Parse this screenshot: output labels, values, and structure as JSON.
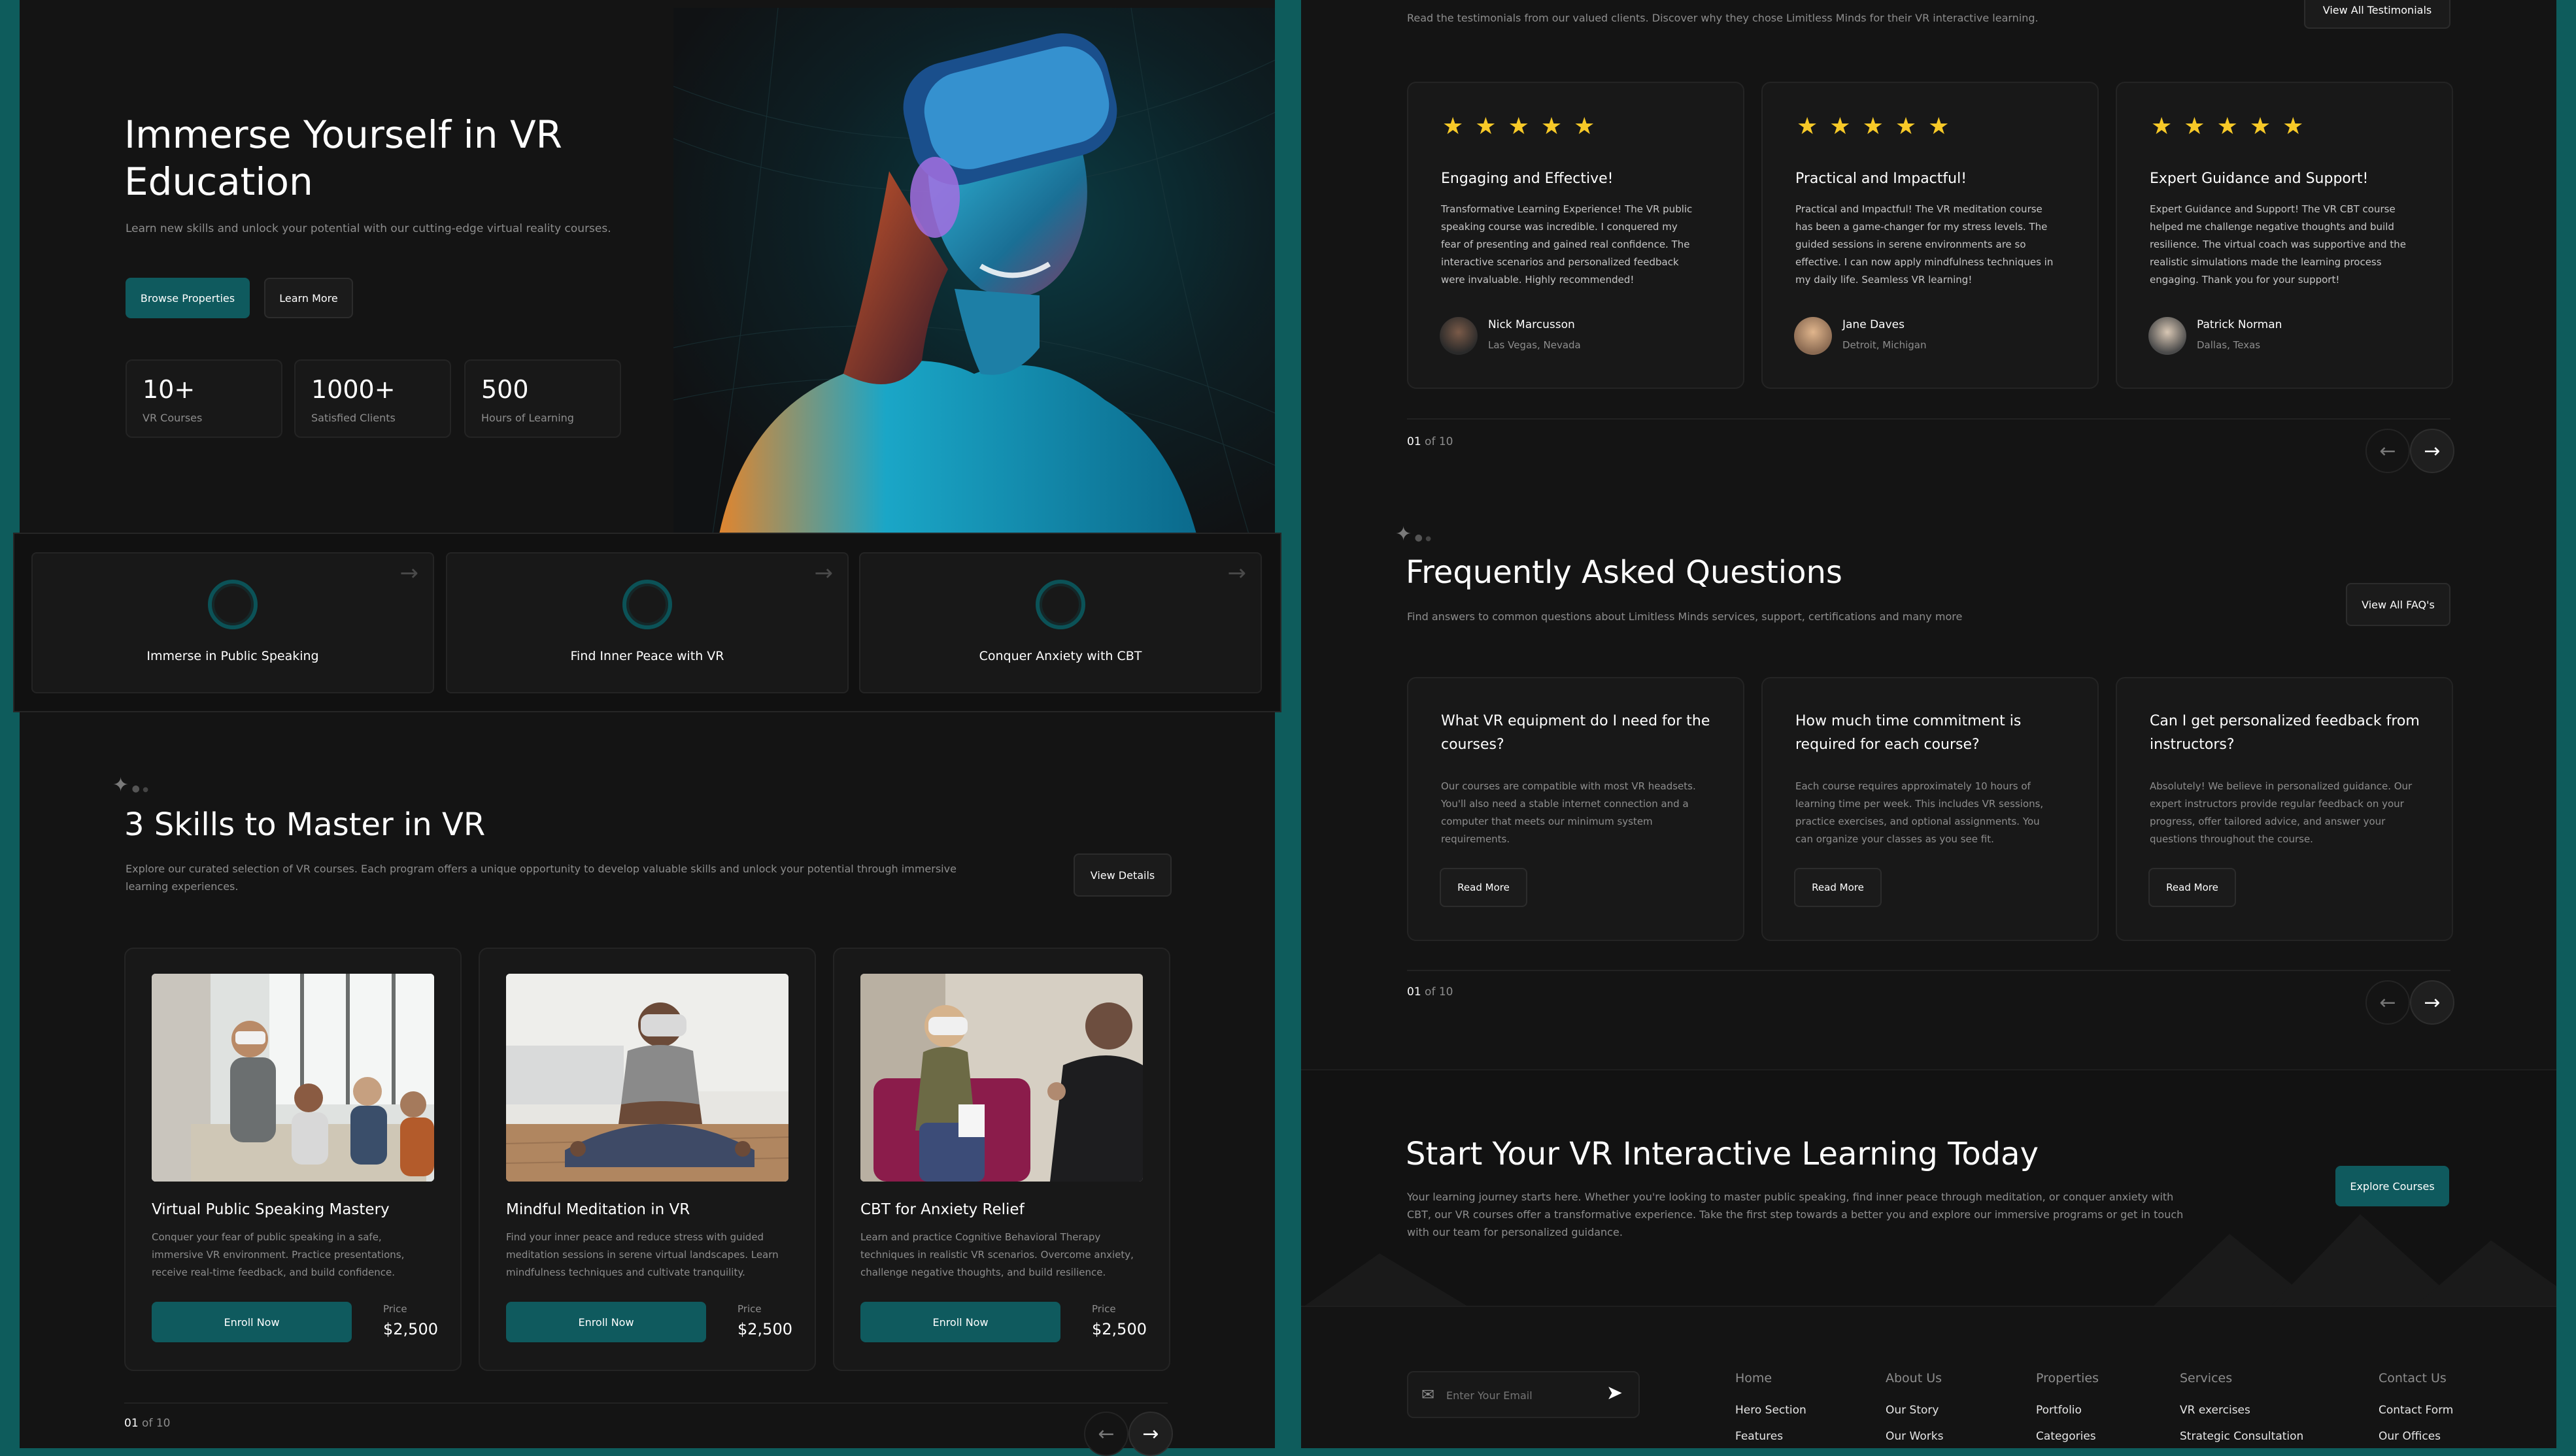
{
  "colors": {
    "background": "#0e5c5c",
    "panel": "#141414",
    "accent": "#0f5a5e",
    "star": "#f7c928"
  },
  "hero": {
    "title_line1": "Immerse Yourself in VR",
    "title_line2": "Education",
    "subtitle": "Learn new skills and unlock your potential with our cutting-edge virtual reality courses.",
    "primary_button": "Browse Properties",
    "secondary_button": "Learn More",
    "stats": [
      {
        "value": "10+",
        "label": "VR Courses"
      },
      {
        "value": "1000+",
        "label": "Satisfied Clients"
      },
      {
        "value": "500",
        "label": "Hours of Learning"
      }
    ]
  },
  "features": [
    {
      "label": "Immerse in Public Speaking",
      "icon": "arrow-up-right-icon"
    },
    {
      "label": "Find Inner Peace with VR",
      "icon": "arrow-up-right-icon"
    },
    {
      "label": "Conquer Anxiety with CBT",
      "icon": "arrow-up-right-icon"
    }
  ],
  "skills": {
    "title": "3 Skills to Master in VR",
    "description_line1": "Explore our curated selection of VR courses. Each program offers a unique opportunity to develop valuable skills and unlock your potential through immersive",
    "description_line2": "learning experiences.",
    "view_button": "View Details",
    "courses": [
      {
        "title": "Virtual Public Speaking Mastery",
        "desc1": "Conquer your fear of public speaking in a safe,",
        "desc2": "immersive VR environment. Practice presentations,",
        "desc3": "receive real-time feedback, and build confidence.",
        "enroll": "Enroll Now",
        "price_label": "Price",
        "price": "$2,500"
      },
      {
        "title": "Mindful Meditation in VR",
        "desc1": "Find your inner peace and reduce stress with guided",
        "desc2": "meditation sessions in serene virtual landscapes. Learn",
        "desc3": "mindfulness techniques and cultivate tranquility.",
        "enroll": "Enroll Now",
        "price_label": "Price",
        "price": "$2,500"
      },
      {
        "title": "CBT for Anxiety Relief",
        "desc1": "Learn and practice Cognitive Behavioral Therapy",
        "desc2": "techniques in realistic VR scenarios. Overcome anxiety,",
        "desc3": "challenge negative thoughts, and build resilience.",
        "enroll": "Enroll Now",
        "price_label": "Price",
        "price": "$2,500"
      }
    ],
    "pager_current": "01",
    "pager_of": " of 10"
  },
  "testimonials": {
    "intro": "Read the testimonials from our valued clients. Discover why they chose Limitless Minds for their VR interactive learning.",
    "view_all": "View All Testimonials",
    "items": [
      {
        "title": "Engaging and Effective!",
        "l1": "Transformative Learning Experience! The VR public",
        "l2": "speaking course was incredible. I conquered my",
        "l3": "fear of presenting and gained real confidence. The",
        "l4": "interactive scenarios and personalized feedback",
        "l5": "were invaluable. Highly recommended!",
        "name": "Nick Marcusson",
        "location": "Las Vegas, Nevada"
      },
      {
        "title": "Practical and Impactful!",
        "l1": "Practical and Impactful! The VR meditation course",
        "l2": "has been a game-changer for my stress levels. The",
        "l3": "guided sessions in serene environments are so",
        "l4": "effective. I can now apply mindfulness techniques in",
        "l5": "my daily life. Seamless VR learning!",
        "name": "Jane Daves",
        "location": "Detroit, Michigan"
      },
      {
        "title": "Expert Guidance and Support!",
        "l1": "Expert Guidance and Support! The VR CBT course",
        "l2": "helped me challenge negative thoughts and build",
        "l3": "resilience. The virtual coach was supportive and the",
        "l4": "realistic simulations made the learning process",
        "l5": "engaging. Thank you for your support!",
        "name": "Patrick Norman",
        "location": "Dallas, Texas"
      }
    ],
    "pager_current": "01",
    "pager_of": " of 10"
  },
  "faq": {
    "title": "Frequently Asked Questions",
    "subtitle": "Find answers to common questions about Limitless Minds services, support, certifications and many more",
    "view_all": "View All FAQ's",
    "items": [
      {
        "q1": "What VR equipment do I need for the",
        "q2": "courses?",
        "a1": "Our courses are compatible with most VR headsets.",
        "a2": "You'll also need a stable internet connection and a",
        "a3": "computer that meets our minimum system",
        "a4": "requirements.",
        "read": "Read More"
      },
      {
        "q1": "How much time commitment is",
        "q2": "required for each course?",
        "a1": "Each course requires approximately 10 hours of",
        "a2": "learning time per week. This includes VR sessions,",
        "a3": "practice exercises, and optional assignments. You",
        "a4": "can organize your classes as you see fit.",
        "read": "Read More"
      },
      {
        "q1": "Can I get personalized feedback from",
        "q2": "instructors?",
        "a1": "Absolutely! We believe in personalized guidance. Our",
        "a2": "expert instructors provide regular feedback on your",
        "a3": "progress, offer tailored advice, and answer your",
        "a4": "questions throughout the course.",
        "read": "Read More"
      }
    ],
    "pager_current": "01",
    "pager_of": " of 10"
  },
  "cta": {
    "title": "Start Your VR Interactive Learning Today",
    "line1": "Your learning journey starts here. Whether you're looking to master public speaking, find inner peace through meditation, or conquer anxiety with",
    "line2": "CBT, our VR courses offer a transformative experience. Take the first step towards a better you and explore our immersive programs or get in touch",
    "line3": "with our team for personalized guidance.",
    "button": "Explore Courses"
  },
  "footer": {
    "email_placeholder": "Enter Your Email",
    "columns": [
      {
        "heading": "Home",
        "links": [
          "Hero Section",
          "Features"
        ]
      },
      {
        "heading": "About Us",
        "links": [
          "Our Story",
          "Our Works"
        ]
      },
      {
        "heading": "Properties",
        "links": [
          "Portfolio",
          "Categories"
        ]
      },
      {
        "heading": "Services",
        "links": [
          "VR exercises",
          "Strategic Consultation"
        ]
      },
      {
        "heading": "Contact Us",
        "links": [
          "Contact Form",
          "Our Offices"
        ]
      }
    ]
  }
}
